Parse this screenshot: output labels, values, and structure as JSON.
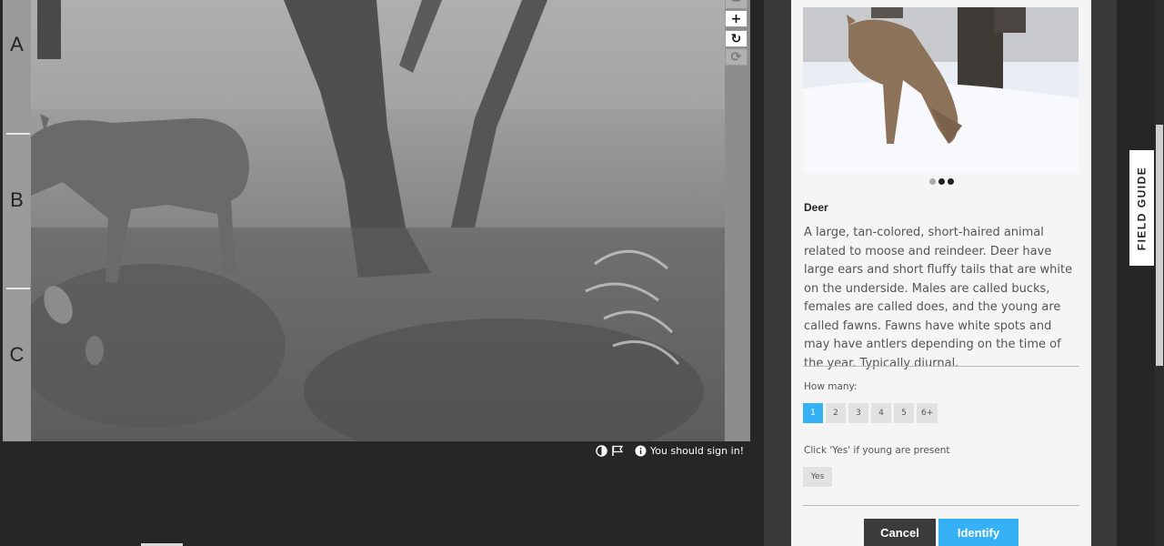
{
  "viewer": {
    "row_labels": [
      "A",
      "B",
      "C"
    ],
    "controls": [
      {
        "name": "zoom-in-button",
        "icon": "plus-icon",
        "glyph": "+"
      },
      {
        "name": "rotate-button",
        "icon": "rotate-icon",
        "glyph": "↻"
      },
      {
        "name": "reset-button",
        "icon": "refresh-icon",
        "glyph": "⟳"
      }
    ]
  },
  "status": {
    "message": "You should sign in!",
    "icons": [
      "contrast-icon",
      "flag-icon",
      "info-icon"
    ]
  },
  "field_guide": {
    "tab_label": "FIELD GUIDE",
    "carousel_dots": 3,
    "carousel_active": 2,
    "species_name": "Deer",
    "description": "A large, tan-colored, short-haired animal related to moose and reindeer. Deer have large ears and short fluffy tails that are white on the underside. Males are called bucks, females are called does, and the young are called fawns. Fawns have white spots and may have antlers depending on the time of the year. Typically diurnal.",
    "how_many_label": "How many:",
    "counts": [
      "1",
      "2",
      "3",
      "4",
      "5",
      "6+"
    ],
    "selected_count": "1",
    "young_label": "Click 'Yes' if young are present",
    "yes_label": "Yes",
    "cancel_label": "Cancel",
    "identify_label": "Identify"
  },
  "colors": {
    "accent": "#36b1f5",
    "background": "#262626",
    "panel": "#f5f5f5",
    "cancel": "#3b3b3b"
  }
}
